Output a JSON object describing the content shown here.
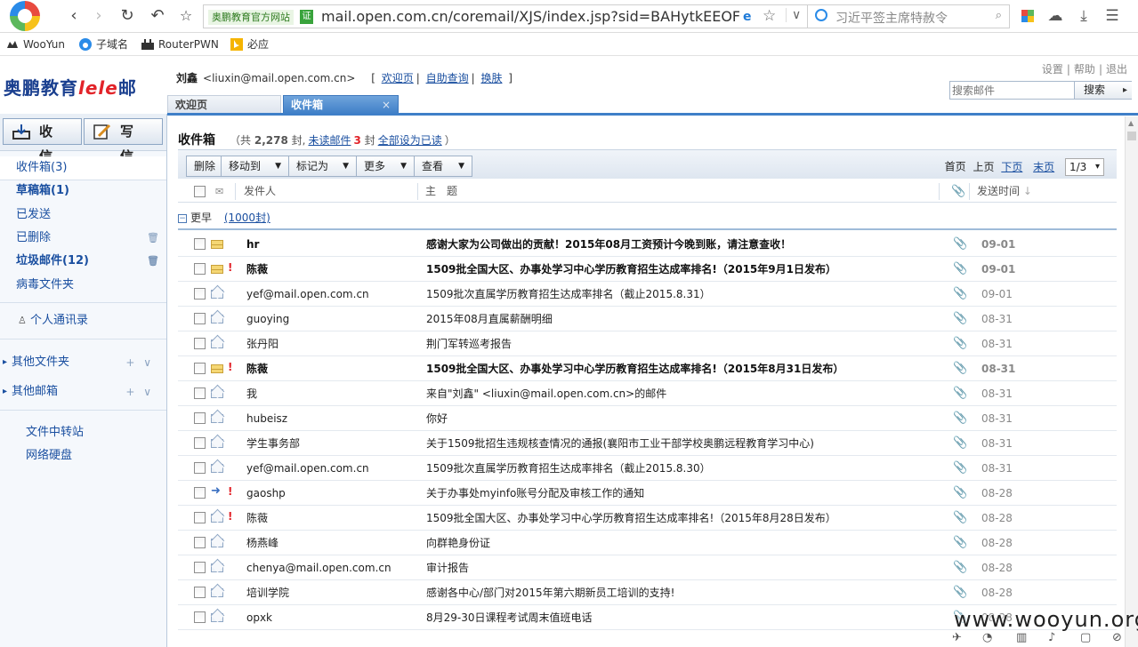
{
  "browser": {
    "site_tag": "奥鹏教育官方网站",
    "verify_label": "证",
    "url": "mail.open.com.cn/coremail/XJS/index.jsp?sid=BAHytkEEOFTyML",
    "search_placeholder": "习近平签主席特赦令",
    "bookmarks": [
      "WooYun",
      "子域名",
      "RouterPWN",
      "必应"
    ]
  },
  "header": {
    "logo_text": "奥鹏教育",
    "logo_lele": "lele",
    "logo_suffix": "邮",
    "user_name": "刘鑫",
    "user_email": "<liuxin@mail.open.com.cn>",
    "links": [
      "欢迎页",
      "自助查询",
      "换肤"
    ],
    "top_links": [
      "设置",
      "帮助",
      "退出"
    ],
    "search_placeholder": "搜索邮件",
    "search_button": "搜索",
    "tabs": [
      "欢迎页",
      "收件箱"
    ],
    "tab_close": "×"
  },
  "sidebar": {
    "receive_button": "收 信",
    "compose_button": "写 信",
    "folders": [
      {
        "label": "收件箱(3)"
      },
      {
        "label": "草稿箱(1)"
      },
      {
        "label": "已发送"
      },
      {
        "label": "已删除"
      },
      {
        "label": "垃圾邮件(12)"
      },
      {
        "label": "病毒文件夹"
      }
    ],
    "contacts": "个人通讯录",
    "groups": [
      "其他文件夹",
      "其他邮箱"
    ],
    "group_actions": "+ ∨",
    "extras": [
      "文件中转站",
      "网络硬盘"
    ]
  },
  "main": {
    "folder_title": "收件箱",
    "meta_prefix": "（共",
    "total": "2,278",
    "meta_unit": "封,",
    "unread_link": "未读邮件",
    "unread_count": "3",
    "meta_unit2": "封",
    "mark_all_read": "全部设为已读",
    "meta_suffix": "）",
    "toolbar": {
      "delete": "删除",
      "move": "移动到",
      "mark": "标记为",
      "more": "更多",
      "view": "查看"
    },
    "pager": {
      "first": "首页",
      "prev": "上页",
      "next": "下页",
      "last": "末页",
      "page": "1/3"
    },
    "columns": {
      "sender": "发件人",
      "subject": "主　题",
      "date": "发送时间"
    },
    "group_label": "更早",
    "group_count": "(1000封)",
    "rows": [
      {
        "sender": "hr",
        "subject": "感谢大家为公司做出的贡献！2015年08月工资预计今晚到账，请注意查收！",
        "date": "09-01",
        "unread": true,
        "flag": false,
        "icon": "unread"
      },
      {
        "sender": "陈薇",
        "subject": "1509批全国大区、办事处学习中心学历教育招生达成率排名!（2015年9月1日发布）",
        "date": "09-01",
        "unread": true,
        "flag": true,
        "icon": "unread"
      },
      {
        "sender": "yef@mail.open.com.cn",
        "subject": "1509批次直属学历教育招生达成率排名（截止2015.8.31）",
        "date": "09-01",
        "unread": false,
        "flag": false,
        "icon": "read"
      },
      {
        "sender": "guoying",
        "subject": "2015年08月直属薪酬明细",
        "date": "08-31",
        "unread": false,
        "flag": false,
        "icon": "read"
      },
      {
        "sender": "张丹阳",
        "subject": "荆门军转巡考报告",
        "date": "08-31",
        "unread": false,
        "flag": false,
        "icon": "read"
      },
      {
        "sender": "陈薇",
        "subject": "1509批全国大区、办事处学习中心学历教育招生达成率排名!（2015年8月31日发布）",
        "date": "08-31",
        "unread": true,
        "flag": true,
        "icon": "unread"
      },
      {
        "sender": "我",
        "subject": "来自\"刘鑫\" <liuxin@mail.open.com.cn>的邮件",
        "date": "08-31",
        "unread": false,
        "flag": false,
        "icon": "read"
      },
      {
        "sender": "hubeisz",
        "subject": "你好",
        "date": "08-31",
        "unread": false,
        "flag": false,
        "icon": "read"
      },
      {
        "sender": "学生事务部",
        "subject": "关于1509批招生违规核查情况的通报(襄阳市工业干部学校奥鹏远程教育学习中心)",
        "date": "08-31",
        "unread": false,
        "flag": false,
        "icon": "read"
      },
      {
        "sender": "yef@mail.open.com.cn",
        "subject": "1509批次直属学历教育招生达成率排名（截止2015.8.30）",
        "date": "08-31",
        "unread": false,
        "flag": false,
        "icon": "read"
      },
      {
        "sender": "gaoshp",
        "subject": "关于办事处myinfo账号分配及审核工作的通知",
        "date": "08-28",
        "unread": false,
        "flag": true,
        "icon": "fwd"
      },
      {
        "sender": "陈薇",
        "subject": "1509批全国大区、办事处学习中心学历教育招生达成率排名!（2015年8月28日发布）",
        "date": "08-28",
        "unread": false,
        "flag": true,
        "icon": "read"
      },
      {
        "sender": "杨燕峰",
        "subject": "向群艳身份证",
        "date": "08-28",
        "unread": false,
        "flag": false,
        "icon": "read"
      },
      {
        "sender": "chenya@mail.open.com.cn",
        "subject": "审计报告",
        "date": "08-28",
        "unread": false,
        "flag": false,
        "icon": "read"
      },
      {
        "sender": "培训学院",
        "subject": "感谢各中心/部门对2015年第六期新员工培训的支持!",
        "date": "08-28",
        "unread": false,
        "flag": false,
        "icon": "read"
      },
      {
        "sender": "opxk",
        "subject": "8月29-30日课程考试周末值班电话",
        "date": "08-28",
        "unread": false,
        "flag": false,
        "icon": "read"
      }
    ]
  },
  "watermark": "www.wooyun.org"
}
